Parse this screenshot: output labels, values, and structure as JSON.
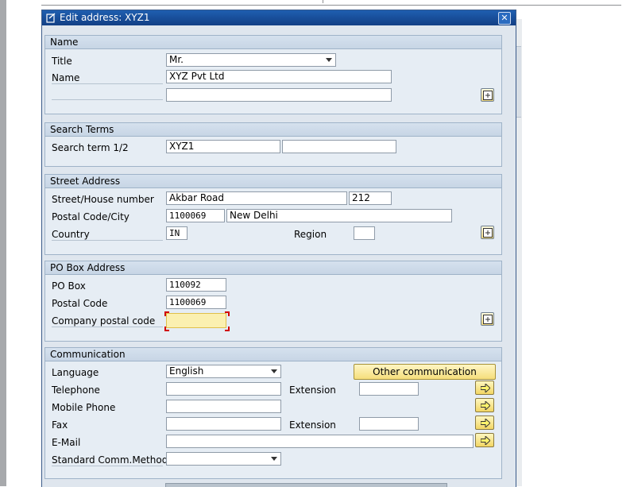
{
  "dialog": {
    "title": "Edit address:  XYZ1",
    "close": "✕"
  },
  "name_group": {
    "header": "Name",
    "title_label": "Title",
    "title_value": "Mr.",
    "name_label": "Name",
    "name_value": "XYZ Pvt Ltd",
    "name2_value": ""
  },
  "search_group": {
    "header": "Search Terms",
    "search_label": "Search term 1/2",
    "search1_value": "XYZ1",
    "search2_value": ""
  },
  "street_group": {
    "header": "Street Address",
    "street_label": "Street/House number",
    "street_value": "Akbar Road",
    "house_value": "212",
    "postal_city_label": "Postal Code/City",
    "postal_value": "1100069",
    "city_value": "New Delhi",
    "country_label": "Country",
    "country_value": "IN",
    "region_label": "Region",
    "region_value": ""
  },
  "pobox_group": {
    "header": "PO Box Address",
    "pobox_label": "PO Box",
    "pobox_value": "110092",
    "postal_label": "Postal Code",
    "postal_value": "1100069",
    "company_postal_label": "Company postal code",
    "company_postal_value": ""
  },
  "comm_group": {
    "header": "Communication",
    "language_label": "Language",
    "language_value": "English",
    "other_comm_label": "Other communication",
    "telephone_label": "Telephone",
    "telephone_value": "",
    "extension_label": "Extension",
    "tel_ext_value": "",
    "mobile_label": "Mobile Phone",
    "mobile_value": "",
    "fax_label": "Fax",
    "fax_value": "",
    "fax_extension_label": "Extension",
    "fax_ext_value": "",
    "email_label": "E-Mail",
    "email_value": "",
    "std_comm_label": "Standard Comm.Method",
    "std_comm_value": ""
  },
  "icons": {
    "more_fields": "expand-fields-icon",
    "navigate": "arrow-right-icon"
  },
  "colors": {
    "titlebar": "#1a52a0",
    "button_yellow": "#f5de7c",
    "required_field": "#fbf0b0",
    "required_marker": "#d00000"
  }
}
